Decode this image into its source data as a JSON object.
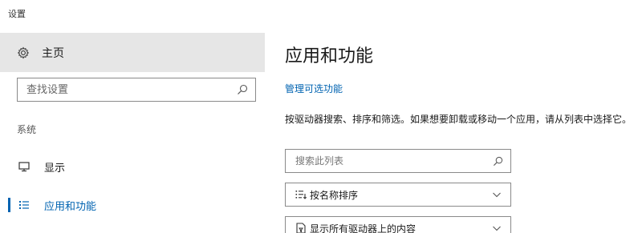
{
  "window": {
    "title": "设置"
  },
  "sidebar": {
    "home": {
      "label": "主页",
      "icon": "gear-icon"
    },
    "search": {
      "placeholder": "查找设置",
      "icon": "search-icon"
    },
    "section_label": "系统",
    "items": [
      {
        "label": "显示",
        "icon": "monitor-icon",
        "selected": false
      },
      {
        "label": "应用和功能",
        "icon": "list-icon",
        "selected": true
      }
    ],
    "accent_color": "#0063b1"
  },
  "main": {
    "title": "应用和功能",
    "manage_link": "管理可选功能",
    "description": "按驱动器搜索、排序和筛选。如果想要卸载或移动一个应用，请从列表中选择它。",
    "list_search": {
      "placeholder": "搜索此列表",
      "icon": "search-icon"
    },
    "sort": {
      "value": "按名称排序",
      "icon": "sort-icon"
    },
    "filter": {
      "value": "显示所有驱动器上的内容",
      "icon": "drive-filter-icon"
    }
  }
}
